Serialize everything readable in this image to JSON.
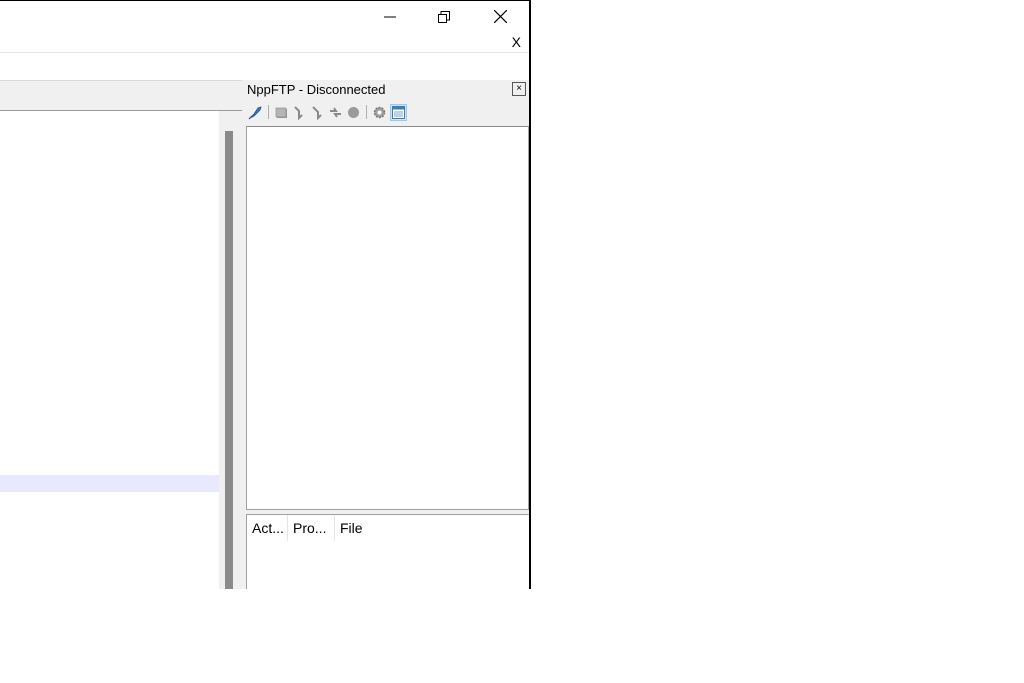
{
  "window": {
    "minimize_icon": "minimize-icon",
    "restore_icon": "restore-icon",
    "close_icon": "close-icon",
    "menu_close_label": "X"
  },
  "nppftp": {
    "title": "NppFTP - Disconnected",
    "close_label": "×",
    "toolbar_icons": [
      "connect-icon",
      "disconnect-icon",
      "download-icon",
      "upload-icon",
      "refresh-icon",
      "abort-icon",
      "settings-icon",
      "message-window-icon"
    ],
    "queue_columns": [
      "Act...",
      "Pro...",
      "File"
    ]
  },
  "colors": {
    "current_line": "#e8e8ff",
    "panel_bg": "#f0f0f0",
    "scroll_thumb": "#8a8a8a"
  }
}
